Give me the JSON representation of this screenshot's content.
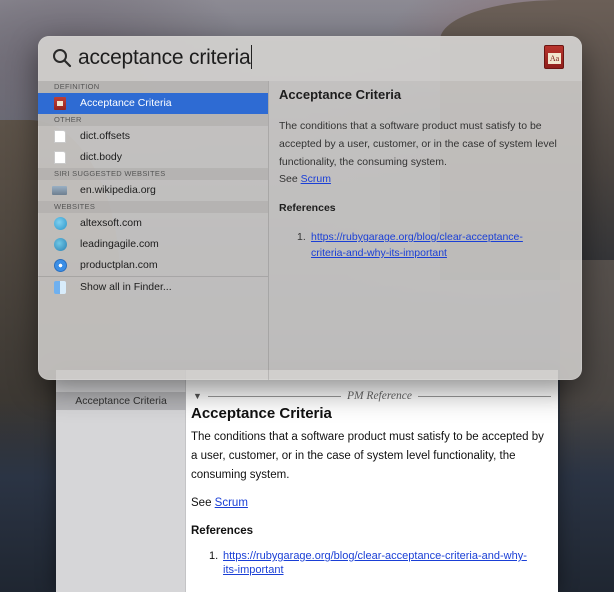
{
  "spotlight": {
    "query": "acceptance criteria",
    "app_icon_text": "Aa",
    "sections": {
      "definition": "DEFINITION",
      "other": "OTHER",
      "siri": "SIRI SUGGESTED WEBSITES",
      "websites": "WEBSITES"
    },
    "results": {
      "definition": [
        "Acceptance Criteria"
      ],
      "other": [
        "dict.offsets",
        "dict.body"
      ],
      "siri": [
        "en.wikipedia.org"
      ],
      "websites": [
        "altexsoft.com",
        "leadingagile.com",
        "productplan.com"
      ],
      "show_all": "Show all in Finder..."
    },
    "preview": {
      "title": "Acceptance Criteria",
      "definition": "The conditions that a software product must satisfy to be accepted by a user, customer, or in the case of system level functionality, the consuming system.",
      "see_prefix": "See",
      "see_link": "Scrum",
      "references_heading": "References",
      "references": [
        {
          "num": "1.",
          "url": "https://rubygarage.org/blog/clear-acceptance-criteria-and-why-its-important"
        }
      ]
    }
  },
  "dictionary_window": {
    "sidebar_selected": "Acceptance Criteria",
    "source_label": "PM Reference",
    "title": "Acceptance Criteria",
    "definition": "The conditions that a software product must satisfy to be accepted by a user, customer, or in the case of system level functionality, the consuming system.",
    "see_prefix": "See",
    "see_link": "Scrum",
    "references_heading": "References",
    "references": [
      {
        "num": "1.",
        "url": "https://rubygarage.org/blog/clear-acceptance-criteria-and-why-its-important"
      }
    ]
  },
  "colors": {
    "selection": "#2e6bd3",
    "link": "#1a3fd6"
  }
}
